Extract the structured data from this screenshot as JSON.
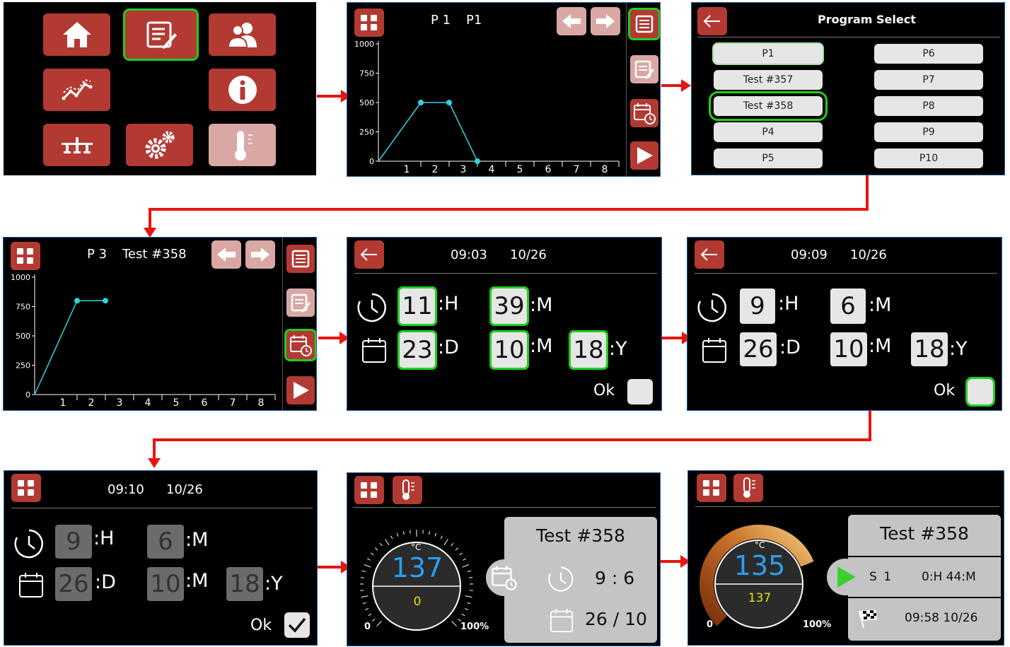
{
  "colors": {
    "button_red": "#b23a33",
    "button_disabled": "#d9a8a4",
    "highlight_green": "#1fd01f",
    "arrow_red": "#e8140e",
    "chart_line": "#2fd3e0",
    "temp_blue": "#2a9ff0",
    "temp_yellow": "#e8e200"
  },
  "menu": {
    "icons": [
      "home-icon",
      "program-edit-icon",
      "users-icon",
      "graph-icon",
      "info-icon",
      "network-icon",
      "settings-icon",
      "thermometer-icon"
    ]
  },
  "program_view_1": {
    "title_prog": "P 1",
    "title_name": "P1",
    "y_ticks": [
      "1000",
      "750",
      "500",
      "250",
      "0"
    ],
    "x_ticks": [
      "1",
      "2",
      "3",
      "4",
      "5",
      "6",
      "7",
      "8"
    ]
  },
  "program_select": {
    "title": "Program Select",
    "left": [
      "P1",
      "Test #357",
      "Test #358",
      "P4",
      "P5"
    ],
    "right": [
      "P6",
      "P7",
      "P8",
      "P9",
      "P10"
    ]
  },
  "program_view_2": {
    "title_prog": "P 3",
    "title_name": "Test #358",
    "y_ticks": [
      "1000",
      "750",
      "500",
      "250",
      "0"
    ],
    "x_ticks": [
      "1",
      "2",
      "3",
      "4",
      "5",
      "6",
      "7",
      "8"
    ]
  },
  "set_time_1": {
    "time": "09:03",
    "date": "10/26",
    "hour": "11",
    "hour_unit": ":H",
    "minute": "39",
    "minute_unit": ":M",
    "day": "23",
    "day_unit": ":D",
    "month": "10",
    "month_unit": ":M",
    "year": "18",
    "year_unit": ":Y",
    "ok": "Ok"
  },
  "set_time_2": {
    "time": "09:09",
    "date": "10/26",
    "hour": "9",
    "hour_unit": ":H",
    "minute": "6",
    "minute_unit": ":M",
    "day": "26",
    "day_unit": ":D",
    "month": "10",
    "month_unit": ":M",
    "year": "18",
    "year_unit": ":Y",
    "ok": "Ok"
  },
  "set_time_3": {
    "time": "09:10",
    "date": "10/26",
    "hour": "9",
    "hour_unit": ":H",
    "minute": "6",
    "minute_unit": ":M",
    "day": "26",
    "day_unit": ":D",
    "month": "10",
    "month_unit": ":M",
    "year": "18",
    "year_unit": ":Y",
    "ok": "Ok"
  },
  "delayed_start": {
    "unit": "°C",
    "temp": "137",
    "setpoint": "0",
    "gauge_min": "0",
    "gauge_max": "100%",
    "program": "Test #358",
    "time": "9 : 6",
    "date": "26 / 10"
  },
  "running": {
    "unit": "°C",
    "temp": "135",
    "setpoint": "137",
    "gauge_min": "0",
    "gauge_max": "100%",
    "gauge_level": 0.75,
    "program": "Test #358",
    "segment": "S 1",
    "remaining": "0:H 44:M",
    "finish": "09:58 10/26"
  },
  "chart_data": [
    {
      "type": "line",
      "name": "P1",
      "x": [
        0,
        1.5,
        2.5,
        3.5
      ],
      "y": [
        0,
        500,
        500,
        0
      ],
      "ylim": [
        0,
        1000
      ],
      "xlim": [
        0,
        8.5
      ],
      "grid": false
    },
    {
      "type": "line",
      "name": "Test #358",
      "x": [
        0,
        1.5,
        2.5
      ],
      "y": [
        0,
        800,
        800
      ],
      "ylim": [
        0,
        1000
      ],
      "xlim": [
        0,
        8.5
      ],
      "grid": false
    }
  ]
}
